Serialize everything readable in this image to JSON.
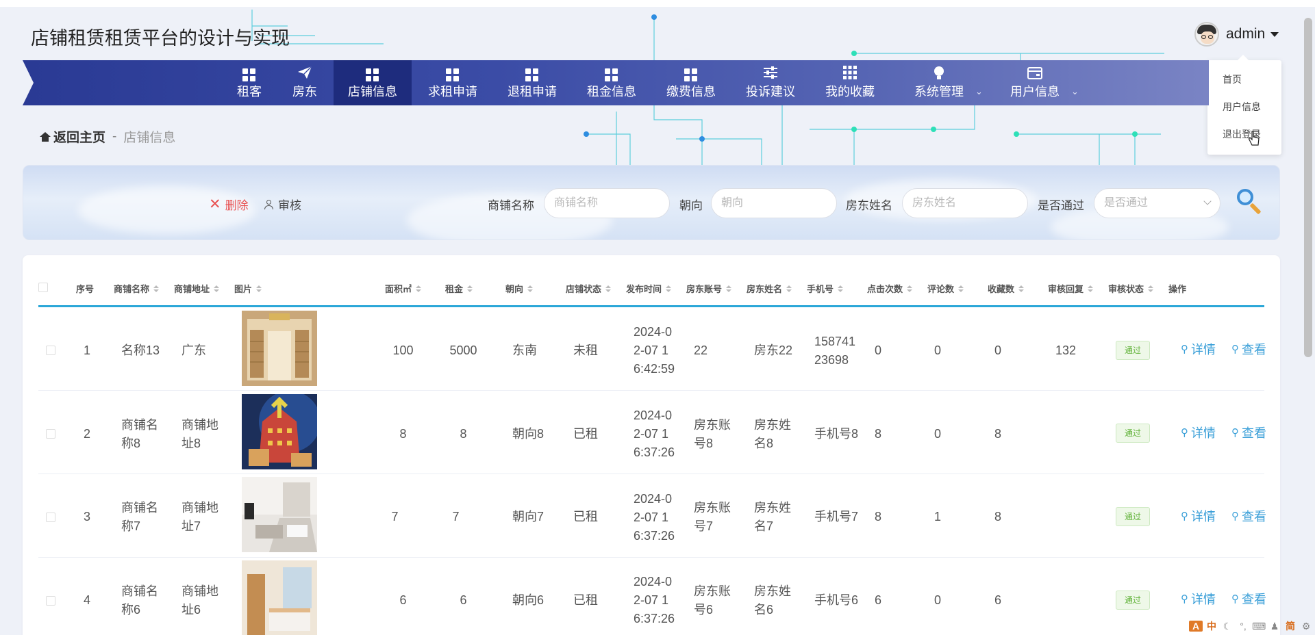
{
  "site": {
    "title": "店铺租赁租赁平台的设计与实现"
  },
  "user": {
    "name": "admin"
  },
  "user_menu": {
    "items": [
      "首页",
      "用户信息",
      "退出登录"
    ]
  },
  "nav": {
    "items": [
      {
        "label": "租客",
        "icon": "grid-icon"
      },
      {
        "label": "房东",
        "icon": "paper-plane-icon"
      },
      {
        "label": "店铺信息",
        "icon": "grid-icon",
        "active": true
      },
      {
        "label": "求租申请",
        "icon": "grid-icon"
      },
      {
        "label": "退租申请",
        "icon": "grid-icon"
      },
      {
        "label": "租金信息",
        "icon": "grid-icon"
      },
      {
        "label": "缴费信息",
        "icon": "grid-icon"
      },
      {
        "label": "投诉建议",
        "icon": "sliders-icon"
      },
      {
        "label": "我的收藏",
        "icon": "apps-icon"
      },
      {
        "label": "系统管理",
        "icon": "lightbulb-icon",
        "has_submenu": true
      },
      {
        "label": "用户信息",
        "icon": "card-icon",
        "has_submenu": true
      }
    ],
    "submenu_glyph": "⌄"
  },
  "breadcrumb": {
    "home": "返回主页",
    "separator": "-",
    "current": "店铺信息"
  },
  "actions": {
    "delete_label": "删除",
    "audit_label": "审核"
  },
  "filters": {
    "shop_name": {
      "label": "商铺名称",
      "placeholder": "商铺名称"
    },
    "orientation": {
      "label": "朝向",
      "placeholder": "朝向"
    },
    "landlord_name": {
      "label": "房东姓名",
      "placeholder": "房东姓名"
    },
    "approved": {
      "label": "是否通过",
      "placeholder": "是否通过"
    }
  },
  "table": {
    "columns": [
      "序号",
      "商铺名称",
      "商铺地址",
      "图片",
      "面积㎡",
      "租金",
      "朝向",
      "店铺状态",
      "发布时间",
      "房东账号",
      "房东姓名",
      "手机号",
      "点击次数",
      "评论数",
      "收藏数",
      "审核回复",
      "审核状态",
      "操作"
    ],
    "rows": [
      {
        "index": "1",
        "name": "名称13",
        "address": "广东",
        "area": "100",
        "rent": "5000",
        "orientation": "东南",
        "status": "未租",
        "time": "2024-0\n2-07 1\n6:42:59",
        "account": "22",
        "landlord": "房东22",
        "phone": "158741\n23698",
        "clicks": "0",
        "comments": "0",
        "favorites": "0",
        "reply": "132",
        "audit": "通过"
      },
      {
        "index": "2",
        "name": "商铺名\n称8",
        "address": "商铺地\n址8",
        "area": "8",
        "rent": "8",
        "orientation": "朝向8",
        "status": "已租",
        "time": "2024-0\n2-07 1\n6:37:26",
        "account": "房东账\n号8",
        "landlord": "房东姓\n名8",
        "phone": "手机号8",
        "clicks": "8",
        "comments": "0",
        "favorites": "8",
        "reply": "",
        "audit": "通过"
      },
      {
        "index": "3",
        "name": "商铺名\n称7",
        "address": "商铺地\n址7",
        "area": "7",
        "rent": "7",
        "orientation": "朝向7",
        "status": "已租",
        "time": "2024-0\n2-07 1\n6:37:26",
        "account": "房东账\n号7",
        "landlord": "房东姓\n名7",
        "phone": "手机号7",
        "clicks": "8",
        "comments": "1",
        "favorites": "8",
        "reply": "",
        "audit": "通过"
      },
      {
        "index": "4",
        "name": "商铺名\n称6",
        "address": "商铺地\n址6",
        "area": "6",
        "rent": "6",
        "orientation": "朝向6",
        "status": "已租",
        "time": "2024-0\n2-07 1\n6:37:26",
        "account": "房东账\n号6",
        "landlord": "房东姓\n名6",
        "phone": "手机号6",
        "clicks": "6",
        "comments": "0",
        "favorites": "6",
        "reply": "",
        "audit": "通过"
      }
    ],
    "row_actions": {
      "detail": "详情",
      "view": "查看"
    }
  },
  "colors": {
    "nav_bg": "#2a3a94",
    "nav_active": "#1e2c7d",
    "accent": "#2aa7d8",
    "link": "#3a9fd8",
    "danger": "#e85050",
    "success": "#62b33a"
  },
  "ime": {
    "items": [
      "中",
      "简"
    ]
  }
}
